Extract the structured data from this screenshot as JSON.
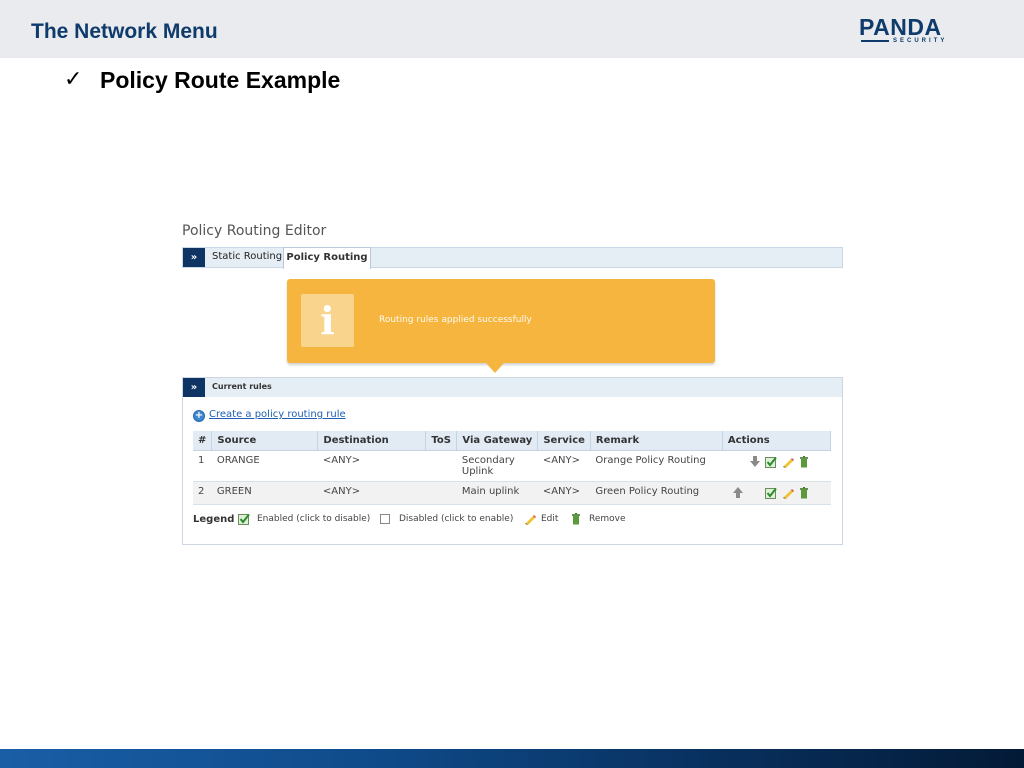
{
  "slide": {
    "title": "The Network Menu",
    "bullet_mark": "✓",
    "bullet_text": "Policy Route Example",
    "logo": {
      "main": "PANDA",
      "sub": "SECURITY"
    }
  },
  "editor": {
    "title": "Policy Routing Editor",
    "expander_glyph": "»",
    "tabs": [
      {
        "label": "Static Routing",
        "active": false
      },
      {
        "label": "Policy Routing",
        "active": true
      }
    ],
    "notice": {
      "icon_glyph": "i",
      "message": "Routing rules applied successfully"
    },
    "rules_panel": {
      "header": "Current rules",
      "create_link": "Create a policy routing rule",
      "plus_glyph": "+",
      "columns": [
        "#",
        "Source",
        "Destination",
        "ToS",
        "Via Gateway",
        "Service",
        "Remark",
        "Actions"
      ],
      "rows": [
        {
          "num": "1",
          "source": "ORANGE",
          "destination": "<ANY>",
          "tos": "",
          "gateway": "Secondary Uplink",
          "service": "<ANY>",
          "remark": "Orange Policy Routing"
        },
        {
          "num": "2",
          "source": "GREEN",
          "destination": "<ANY>",
          "tos": "",
          "gateway": "Main uplink",
          "service": "<ANY>",
          "remark": "Green Policy Routing"
        }
      ]
    },
    "legend": {
      "title": "Legend",
      "enabled": "Enabled (click to disable)",
      "disabled": "Disabled (click to enable)",
      "edit": "Edit",
      "remove": "Remove"
    },
    "icons": {
      "move_down": "arrow-down-icon",
      "move_up": "arrow-up-icon",
      "enabled": "checkbox-checked-icon",
      "edit": "pencil-icon",
      "remove": "trash-icon"
    },
    "colors": {
      "source_orange": "#f28c1e",
      "source_green": "#2e8b2e",
      "gateway": "#b3261e",
      "notice_bg": "#f5b53e",
      "expander_bg": "#0d3463"
    }
  }
}
